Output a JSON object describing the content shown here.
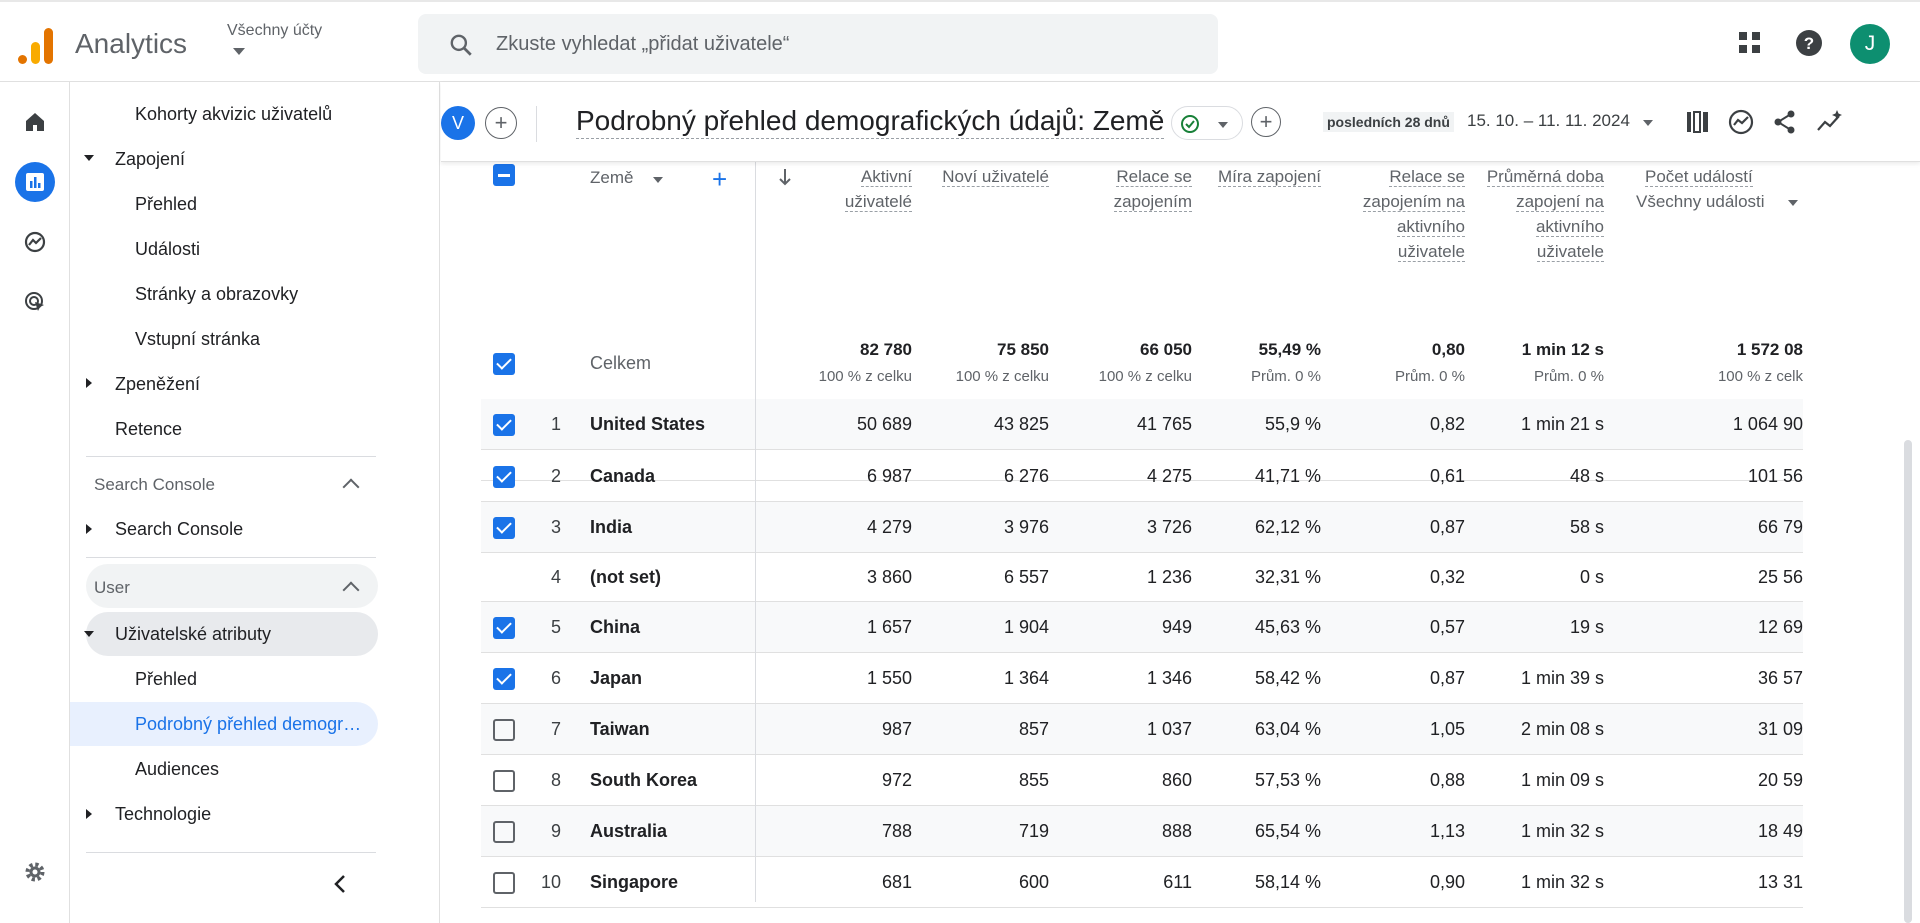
{
  "topbar": {
    "app_name": "Analytics",
    "account_label": "Všechny účty",
    "search_placeholder": "Zkuste vyhledat „přidat uživatele“",
    "avatar_initial": "J"
  },
  "sidebar": {
    "items": [
      {
        "label": "Kohorty akvizic uživatelů"
      },
      {
        "label": "Zapojení"
      },
      {
        "label": "Přehled"
      },
      {
        "label": "Události"
      },
      {
        "label": "Stránky a obrazovky"
      },
      {
        "label": "Vstupní stránka"
      },
      {
        "label": "Zpeněžení"
      },
      {
        "label": "Retence"
      },
      {
        "label": "Search Console"
      },
      {
        "label": "Search Console"
      },
      {
        "label": "User"
      },
      {
        "label": "Uživatelské atributy"
      },
      {
        "label": "Přehled"
      },
      {
        "label": "Podrobný přehled demogr…"
      },
      {
        "label": "Audiences"
      },
      {
        "label": "Technologie"
      }
    ]
  },
  "header": {
    "comparison_chip": "V",
    "title": "Podrobný přehled demografických údajů: Země",
    "date_label": "posledních 28 dnů",
    "date_range": "15. 10. – 11. 11. 2024"
  },
  "table": {
    "dimension_header": "Země",
    "columns": [
      {
        "label": "Aktivní uživatelé"
      },
      {
        "label": "Noví uživatelé"
      },
      {
        "label": "Relace se zapojením"
      },
      {
        "label": "Míra zapojení"
      },
      {
        "label": "Relace se zapojením na aktivního uživatele"
      },
      {
        "label": "Průměrná doba zapojení na aktivního uživatele"
      },
      {
        "label": "Počet událostí",
        "selector": "Všechny události"
      }
    ],
    "totals": {
      "label": "Celkem",
      "values": [
        "82 780",
        "75 850",
        "66 050",
        "55,49 %",
        "0,80",
        "1 min 12 s",
        "1 572 08"
      ],
      "subs": [
        "100 % z celku",
        "100 % z celku",
        "100 % z celku",
        "Prům. 0 %",
        "Prům. 0 %",
        "Prům. 0 %",
        "100 % z celk"
      ]
    },
    "rows": [
      {
        "idx": "1",
        "country": "United States",
        "checked": true,
        "values": [
          "50 689",
          "43 825",
          "41 765",
          "55,9 %",
          "0,82",
          "1 min 21 s",
          "1 064 90"
        ]
      },
      {
        "idx": "2",
        "country": "Canada",
        "checked": true,
        "values": [
          "6 987",
          "6 276",
          "4 275",
          "41,71 %",
          "0,61",
          "48 s",
          "101 56"
        ]
      },
      {
        "idx": "3",
        "country": "India",
        "checked": true,
        "values": [
          "4 279",
          "3 976",
          "3 726",
          "62,12 %",
          "0,87",
          "58 s",
          "66 79"
        ]
      },
      {
        "idx": "4",
        "country": "(not set)",
        "checked": null,
        "values": [
          "3 860",
          "6 557",
          "1 236",
          "32,31 %",
          "0,32",
          "0 s",
          "25 56"
        ]
      },
      {
        "idx": "5",
        "country": "China",
        "checked": true,
        "values": [
          "1 657",
          "1 904",
          "949",
          "45,63 %",
          "0,57",
          "19 s",
          "12 69"
        ]
      },
      {
        "idx": "6",
        "country": "Japan",
        "checked": true,
        "values": [
          "1 550",
          "1 364",
          "1 346",
          "58,42 %",
          "0,87",
          "1 min 39 s",
          "36 57"
        ]
      },
      {
        "idx": "7",
        "country": "Taiwan",
        "checked": false,
        "values": [
          "987",
          "857",
          "1 037",
          "63,04 %",
          "1,05",
          "2 min 08 s",
          "31 09"
        ]
      },
      {
        "idx": "8",
        "country": "South Korea",
        "checked": false,
        "values": [
          "972",
          "855",
          "860",
          "57,53 %",
          "0,88",
          "1 min 09 s",
          "20 59"
        ]
      },
      {
        "idx": "9",
        "country": "Australia",
        "checked": false,
        "values": [
          "788",
          "719",
          "888",
          "65,54 %",
          "1,13",
          "1 min 32 s",
          "18 49"
        ]
      },
      {
        "idx": "10",
        "country": "Singapore",
        "checked": false,
        "values": [
          "681",
          "600",
          "611",
          "58,14 %",
          "0,90",
          "1 min 32 s",
          "13 31"
        ]
      }
    ]
  },
  "colors": {
    "accent": "#1a73e8",
    "selected_bg": "#e8f0fe",
    "avatar": "#0d8f70",
    "logo_orange": "#e37400",
    "logo_yellow": "#f9ab00"
  }
}
